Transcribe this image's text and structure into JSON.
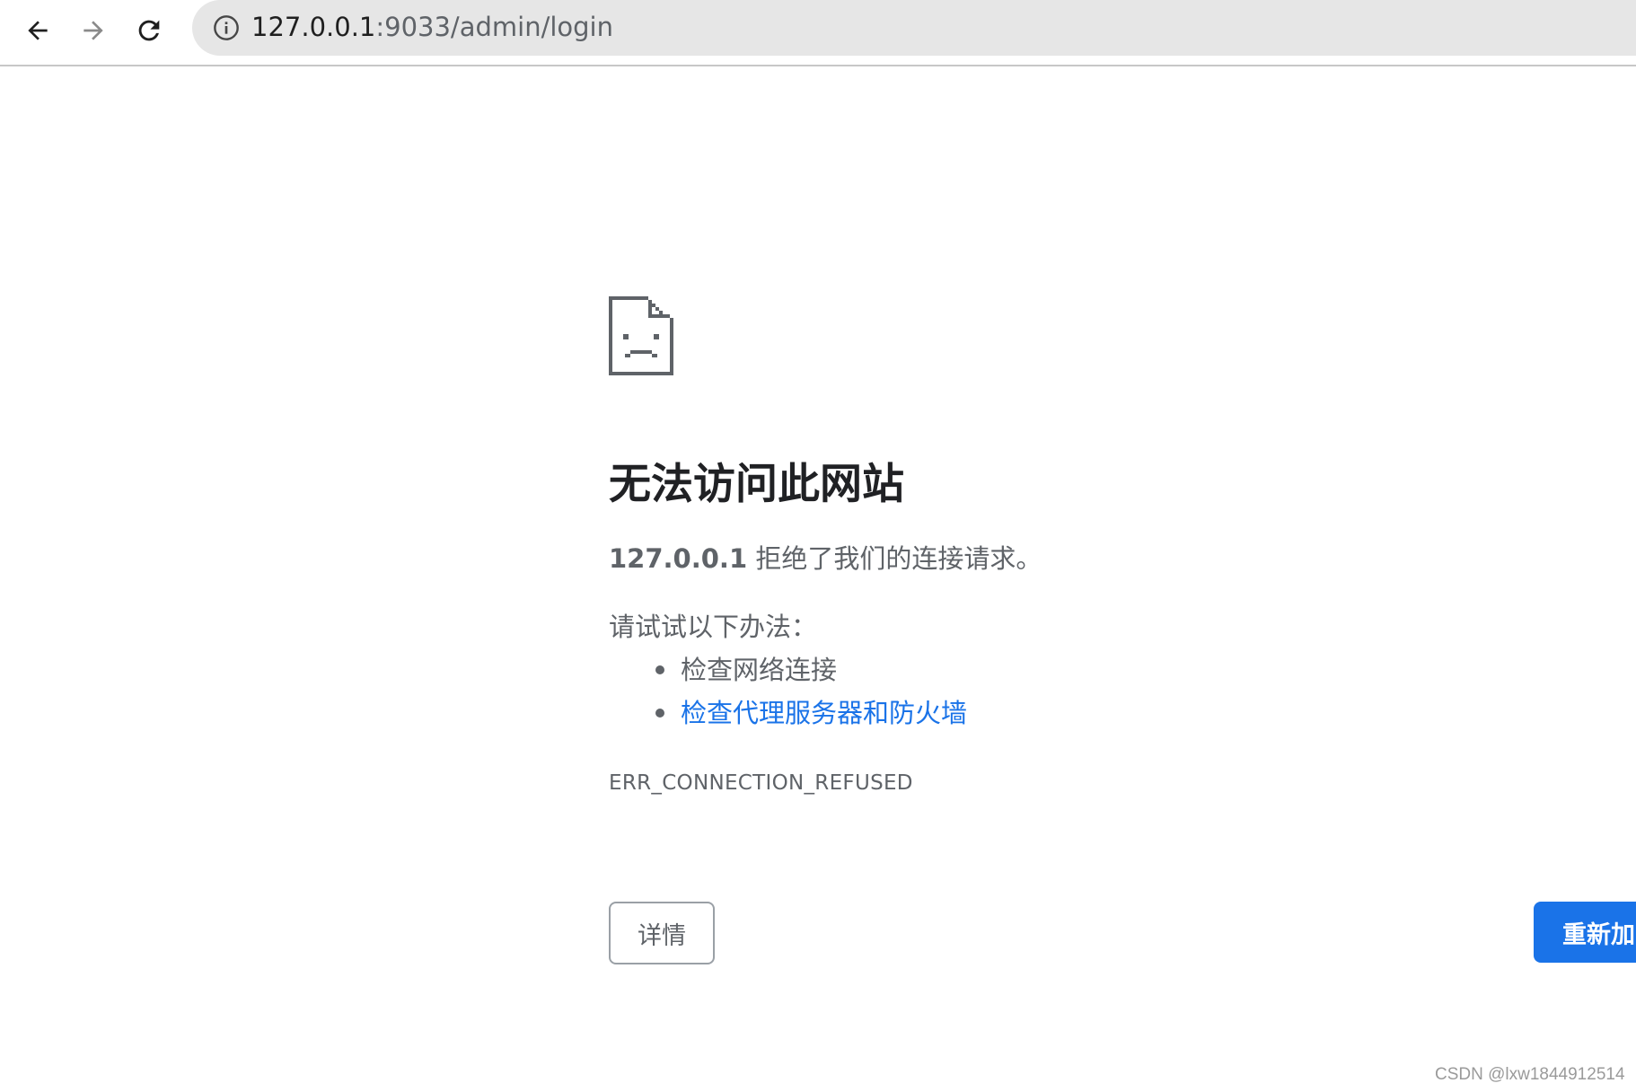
{
  "browser": {
    "url_host": "127.0.0.1",
    "url_path": ":9033/admin/login",
    "icons": {
      "back": "arrow-left-icon",
      "forward": "arrow-right-icon",
      "reload": "reload-icon",
      "site_info": "info-icon"
    }
  },
  "error_page": {
    "icon": "sad-page-icon",
    "title": "无法访问此网站",
    "summary_host": "127.0.0.1",
    "summary_text": " 拒绝了我们的连接请求。",
    "suggestions_heading": "请试试以下办法：",
    "suggestions": [
      {
        "text": "检查网络连接",
        "is_link": false
      },
      {
        "text": "检查代理服务器和防火墙",
        "is_link": true
      }
    ],
    "error_code": "ERR_CONNECTION_REFUSED",
    "details_button": "详情",
    "reload_button": "重新加"
  },
  "watermark": "CSDN @lxw1844912514",
  "colors": {
    "link": "#1a73e8",
    "primary_button": "#1a73e8",
    "text_secondary": "#5f6368",
    "title": "#202124",
    "omnibox_bg": "#e6e6e6"
  }
}
